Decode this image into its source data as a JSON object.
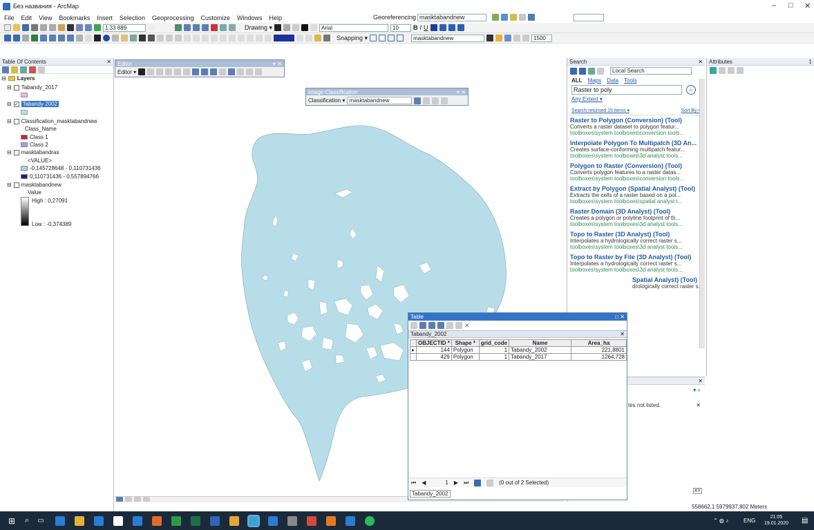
{
  "window": {
    "title": "Без названия - ArcMap",
    "minimize": "–",
    "maximize": "□",
    "close": "✕"
  },
  "menu": [
    "File",
    "Edit",
    "View",
    "Bookmarks",
    "Insert",
    "Selection",
    "Geoprocessing",
    "Customize",
    "Windows",
    "Help"
  ],
  "georef": {
    "label": "Georeferencing ▾",
    "layer": "masktabandnew"
  },
  "toolbar": {
    "scale": "1:33 889",
    "drawing": "Drawing ▾",
    "font": "Arial",
    "font_size": "10",
    "snapping": "Snapping ▾",
    "layer2": "masktabandnew",
    "value": "1500"
  },
  "toc": {
    "title": "Table Of Contents",
    "layers_root": "Layers",
    "items": [
      {
        "label": "Tabandy_2017",
        "checked": false
      },
      {
        "label": "Tabandy 2002",
        "checked": true
      },
      {
        "label": "Classification_masktabandnew",
        "checked": false
      },
      {
        "label": "Class_Name"
      },
      {
        "label": "Class 1"
      },
      {
        "label": "Class 2"
      },
      {
        "label": "masktabandras",
        "checked": false
      },
      {
        "label": "<VALUE>"
      },
      {
        "label": "-0,145728648 - 0,110731436"
      },
      {
        "label": "0,110731436 - 0,557894766"
      },
      {
        "label": "masktabandnew",
        "checked": false
      },
      {
        "label": "Value"
      },
      {
        "label": "High : 0,27091"
      },
      {
        "label": "Low : -0,374389"
      }
    ]
  },
  "editor": {
    "title": "Editor",
    "label": "Editor ▾"
  },
  "image_class": {
    "title": "Image Classification",
    "label": "Classification ▾",
    "layer": "masktabandnew"
  },
  "search": {
    "title": "Search",
    "scope": "Local Search",
    "tabs": [
      "ALL",
      "Maps",
      "Data",
      "Tools"
    ],
    "query": "Raster to poly",
    "extent": "Any Extent ▾",
    "returned": "Search returned 15 items ▾",
    "sort": "Sort By ▾",
    "results": [
      {
        "title": "Raster to Polygon (Conversion) (Tool)",
        "desc": "Converts a raster dataset to polygon featur...",
        "path": "toolboxes\\system toolboxes\\conversion tools..."
      },
      {
        "title": "Interpolate Polygon To Multipatch (3D An...",
        "desc": "Creates surface-conforming multipatch featur...",
        "path": "toolboxes\\system toolboxes\\3d analyst tools..."
      },
      {
        "title": "Polygon to Raster (Conversion) (Tool)",
        "desc": "Converts polygon features to a raster datas...",
        "path": "toolboxes\\system toolboxes\\conversion tools..."
      },
      {
        "title": "Extract by Polygon (Spatial Analyst) (Tool)",
        "desc": "Extracts the cells of a raster based on a pol...",
        "path": "toolboxes\\system toolboxes\\spatial analyst t..."
      },
      {
        "title": "Raster Domain (3D Analyst) (Tool)",
        "desc": "Creates a polygon or polyline footprint of th...",
        "path": "toolboxes\\system toolboxes\\3d analyst tools..."
      },
      {
        "title": "Topo to Raster (3D Analyst) (Tool)",
        "desc": "Interpolates a hydrologically correct raster s...",
        "path": "toolboxes\\system toolboxes\\3d analyst tools..."
      },
      {
        "title": "Topo to Raster by File (3D Analyst) (Tool)",
        "desc": "Interpolates a hydrologically correct raster s...",
        "path": "toolboxes\\system toolboxes\\3d analyst tools..."
      },
      {
        "title": "Spatial Analyst) (Tool)",
        "desc": "drologically correct raster s...",
        "path": ""
      }
    ]
  },
  "attributes": {
    "title": "Attributes"
  },
  "lower_panel": {
    "msg": "tes not listed.",
    "page": "1"
  },
  "table": {
    "title": "Table",
    "tab_name": "Tabandy_2002",
    "columns": [
      "OBJECTID *",
      "Shape *",
      "grid_code",
      "Name",
      "Area_ha"
    ],
    "rows": [
      [
        "144",
        "Polygon",
        "1",
        "Tabandy_2002",
        "221,8801"
      ],
      [
        "429",
        "Polygon",
        "1",
        "Tabandy_2017",
        "1264,728"
      ]
    ],
    "nav": "1",
    "selected": "(0 out of 2 Selected)",
    "bottom_tab": "Tabandy_2002"
  },
  "status": {
    "coords": "558662,1 5979937,802 Meters"
  },
  "taskbar": {
    "lang": "ENG",
    "time": "21:05",
    "date": "19.01.2020"
  },
  "colors": {
    "map_fill": "#b7dde8",
    "class1": "#c0273d",
    "class2": "#a99ee0",
    "range1": "#a9d3ea",
    "range2": "#1c1a8c"
  }
}
